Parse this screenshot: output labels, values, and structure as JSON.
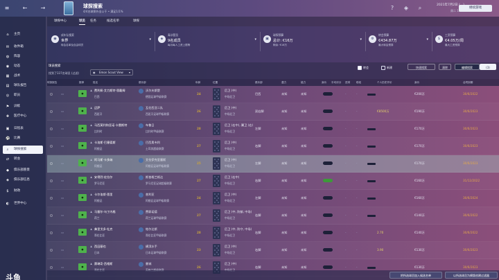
{
  "topbar": {
    "title": "球探搜索",
    "subtitle": "4/4名球探外出公干 • 满足1/1%",
    "date": "2021年7月2日 (...)",
    "time": "周二 15:14",
    "continue_label": "继续游戏"
  },
  "sidebar": {
    "items": [
      {
        "label": "主页",
        "icon": "⌂"
      },
      {
        "label": "收件箱",
        "icon": "✉"
      },
      {
        "label": "阵容",
        "icon": "◍"
      },
      {
        "label": "动态",
        "icon": "◉"
      },
      {
        "label": "战术",
        "icon": "▦"
      },
      {
        "label": "球队报告",
        "icon": "▤"
      },
      {
        "label": "职员",
        "icon": "◎"
      },
      {
        "label": "训练",
        "icon": "⚑"
      },
      {
        "label": "医疗中心",
        "icon": "✚"
      },
      {
        "label": "日程表",
        "icon": "▣"
      },
      {
        "label": "比赛",
        "icon": "⚽"
      },
      {
        "label": "球探搜索",
        "icon": "⌕"
      },
      {
        "label": "转会",
        "icon": "⇄"
      },
      {
        "label": "俱乐部愿景",
        "icon": "◆"
      },
      {
        "label": "俱乐部信息",
        "icon": "◈"
      },
      {
        "label": "财政",
        "icon": "$"
      },
      {
        "label": "世界中心",
        "icon": "◐"
      }
    ],
    "active_index": 11,
    "brand": "斗鱼"
  },
  "tabs": [
    "球探中心",
    "球员",
    "任务",
    "候选名单",
    "球探"
  ],
  "active_tab": 1,
  "stats": [
    {
      "label": "成年队搜索",
      "value": "世界",
      "sub": "转会名单及自由球员",
      "icon": "◉"
    },
    {
      "label": "青训营员",
      "value": "9名成员",
      "sub": "每月每人工资上限等",
      "icon": "◈"
    },
    {
      "label": "球探预算",
      "value": "总计: €16万",
      "sub": "剩余: €16万",
      "icon": "▣"
    },
    {
      "label": "转会预算",
      "value": "€434.87万",
      "sub": "最大转会预算",
      "icon": "⚙"
    },
    {
      "label": "工资预算",
      "value": "€4.05万/周",
      "sub": "最大工资预算",
      "icon": "$"
    }
  ],
  "section": {
    "title": "球员搜索",
    "subtitle": "找到了337名球员 (过滤)",
    "view": "Emon Scout View",
    "cb_injured": "转会",
    "cb_new": "新建",
    "quick_search": "快速搜索",
    "clear": "清除",
    "edit_search": "编辑搜索",
    "count": "(3)"
  },
  "headers": [
    "球探报告",
    "推荐",
    "姓名",
    "俱乐部",
    "年龄",
    "位置",
    "俱乐部",
    "潜力",
    "能力",
    "身价",
    "平均评分",
    "进球",
    "助攻",
    "个人历史开价",
    "身价",
    "合同到期"
  ],
  "rows": [
    {
      "name": "费利佩·艾力斯特·恩戴姆",
      "nation": "巴西",
      "club": "沃尔夫斯堡",
      "league": "德国足球甲级联赛",
      "age": "24",
      "pos1": "后卫 (中)",
      "pos2": "中场后卫",
      "c1": "巴西",
      "c2": "未知",
      "c3": "未知",
      "value": "€200万",
      "contract": "30/6/2022",
      "pill": ""
    },
    {
      "name": "迈萨",
      "nation": "西班牙",
      "club": "瓦伦西亚二队",
      "league": "西班牙足球甲级联赛",
      "age": "26",
      "pos1": "后卫 (中)",
      "pos2": "中场后卫",
      "c1": "双右脚",
      "c2": "未知",
      "c3": "未知",
      "value": "€190万",
      "contract": "30/6/2023",
      "pill": "",
      "ask": "€8500万"
    },
    {
      "name": "马西莫利和亚诺·卡雷斯特",
      "nation": "比利时",
      "club": "布鲁日",
      "league": "比利时甲级联赛",
      "age": "28",
      "pos1": "后卫 (右中), 翼卫 (右)",
      "pos2": "中场后卫",
      "c1": "左脚",
      "c2": "未知",
      "c3": "未知",
      "value": "€170万",
      "contract": "30/6/2023",
      "pill": ""
    },
    {
      "name": "卡洛斯·巴塞德斯",
      "nation": "阿根廷",
      "club": "巴西奥韦利",
      "league": "土耳其超级联赛",
      "age": "27",
      "pos1": "后卫 (中)",
      "pos2": "中场后卫",
      "c1": "右脚",
      "c2": "未知",
      "c3": "未知",
      "value": "€170万",
      "contract": "30/6/2023",
      "pill": ""
    },
    {
      "name": "阿马斯·卡多纳",
      "nation": "阿根廷",
      "club": "艾拉伊克里塞斯",
      "league": "阿根廷足球甲级联赛",
      "age": "25",
      "pos1": "后卫 (中)",
      "pos2": "中场后卫",
      "c1": "左脚",
      "c2": "未知",
      "c3": "未知",
      "value": "€170万",
      "contract": "30/6/2023",
      "pill": "",
      "hl": true
    },
    {
      "name": "安得烈·佐拉尔",
      "nation": "罗马尼亚",
      "club": "斯普格兰格达",
      "league": "罗马尼亚足球超级联赛",
      "age": "27",
      "pos1": "后卫 (右中)",
      "pos2": "中场后卫",
      "c1": "右脚",
      "c2": "未知",
      "c3": "未知",
      "value": "€160万",
      "contract": "31/12/2022",
      "pill": "green"
    },
    {
      "name": "卡尔洛斯·恩里",
      "nation": "阿根廷",
      "club": "普利亚",
      "league": "阿根廷足球甲级联赛",
      "age": "24",
      "pos1": "后卫 (中)",
      "pos2": "中场后卫",
      "c1": "左脚",
      "c2": "未知",
      "c3": "未知",
      "value": "€160万",
      "contract": "30/6/2024",
      "pill": ""
    },
    {
      "name": "马塞尔·乌丁内格",
      "nation": "荷兰",
      "club": "费耶诺德",
      "league": "荷兰足球甲级联赛",
      "age": "27",
      "pos1": "后卫 (中, 防御, 中场)",
      "pos2": "中场后卫",
      "c1": "右脚",
      "c2": "未知",
      "c3": "未知",
      "value": "€140万",
      "contract": "30/6/2022",
      "pill": ""
    },
    {
      "name": "弗里戈多·杜克",
      "nation": "哥伦比亚",
      "club": "帕尔达斯",
      "league": "哥伦比亚甲级联赛",
      "age": "28",
      "pos1": "后卫 (中, 防守, 中场)",
      "pos2": "中场后卫",
      "c1": "右脚",
      "c2": "未知",
      "c3": "未知",
      "value": "€140万",
      "contract": "30/6/2022",
      "pill": "",
      "ask": "2.70"
    },
    {
      "name": "西田基也",
      "nation": "日本",
      "club": "横滨水手",
      "league": "日本足球甲级联赛",
      "age": "23",
      "pos1": "后卫 (中)",
      "pos2": "中场后卫",
      "c1": "右脚",
      "c2": "未知",
      "c3": "未知",
      "value": "€130万",
      "contract": "30/6/2023",
      "pill": "",
      "ask": "3.90"
    },
    {
      "name": "赛琳奇·西格斯",
      "nation": "哥伦比亚",
      "club": "曼城",
      "league": "英格兰超级联赛",
      "age": "26",
      "pos1": "后卫 (中)",
      "pos2": "中场后卫",
      "c1": "右脚",
      "c2": "未知",
      "c3": "未知",
      "value": "€130万",
      "contract": "30/6/2023",
      "pill": ""
    }
  ],
  "footer": {
    "add_shortlist": "把所选球员加入候选名单",
    "exclude": "以所选球员为模版创建过滤器"
  }
}
